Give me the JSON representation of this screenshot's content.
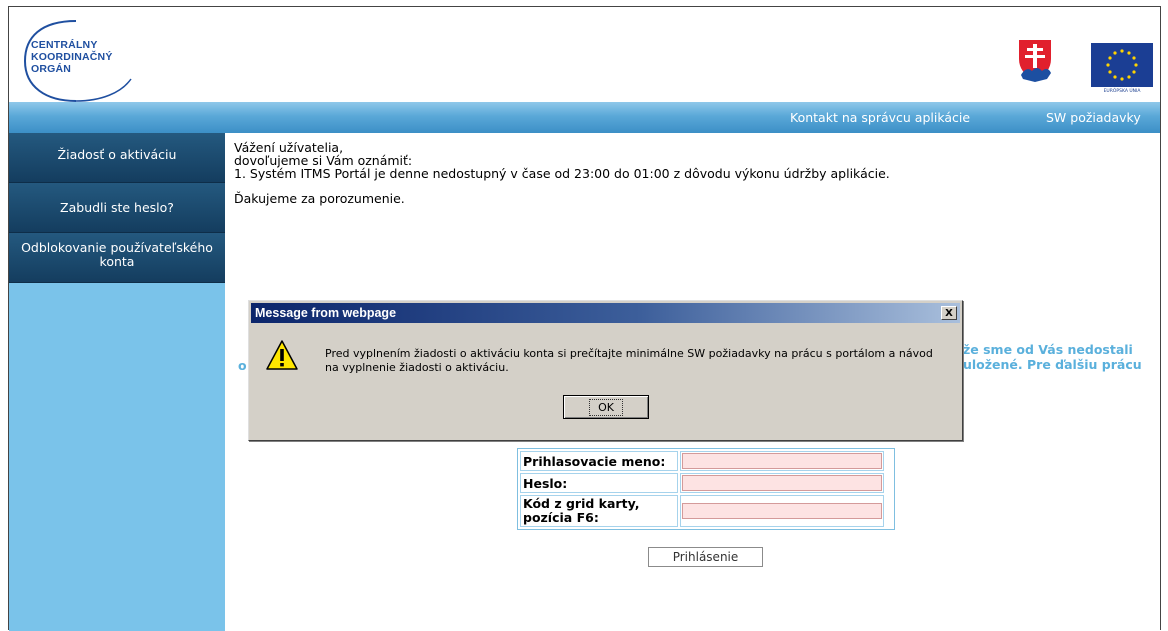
{
  "header": {
    "logo_lines": [
      "CENTRÁLNY",
      "KOORDINAČNÝ",
      "ORGÁN"
    ],
    "eu_caption": "EURÓPSKA ÚNIA"
  },
  "nav": {
    "contact": "Kontakt na správcu aplikácie",
    "sw": "SW požiadavky"
  },
  "sidebar": {
    "items": [
      {
        "label": "Žiadosť o aktiváciu"
      },
      {
        "label": "Zabudli ste heslo?"
      },
      {
        "label": "Odblokovanie používateľského konta"
      }
    ]
  },
  "main": {
    "greeting": "Vážení užívatelia,",
    "intro": "dovoľujeme si Vám oznámiť:",
    "item1": "1. Systém ITMS Portál je denne nedostupný v čase od 23:00 do 01:00 z dôvodu výkonu údržby aplikácie.",
    "thanks": "Ďakujeme za porozumenie.",
    "partial_right_1": "že sme od Vás nedostali",
    "partial_right_2": "uložené. Pre ďalšiu prácu",
    "partial_left": "o"
  },
  "login": {
    "username_label": "Prihlasovacie meno:",
    "password_label": "Heslo:",
    "grid_label": "Kód z grid karty, pozícia F6:",
    "submit": "Prihlásenie"
  },
  "dialog": {
    "title": "Message from webpage",
    "close_glyph": "X",
    "message": "Pred vyplnením žiadosti o aktiváciu konta si prečítajte minimálne SW požiadavky na prácu s portálom a návod na vyplnenie žiadosti o aktiváciu.",
    "ok": "OK"
  },
  "colors": {
    "nav_blue": "#4a9fd4",
    "sidebar_bg": "#7ac3ea",
    "sidebar_item": "#1d4b70",
    "input_bg": "#fde3e3",
    "dialog_title": "#0b256b"
  },
  "icons": {
    "warning": "warning-icon",
    "coat": "slovak-coat-of-arms-icon",
    "eu": "eu-flag-icon"
  }
}
